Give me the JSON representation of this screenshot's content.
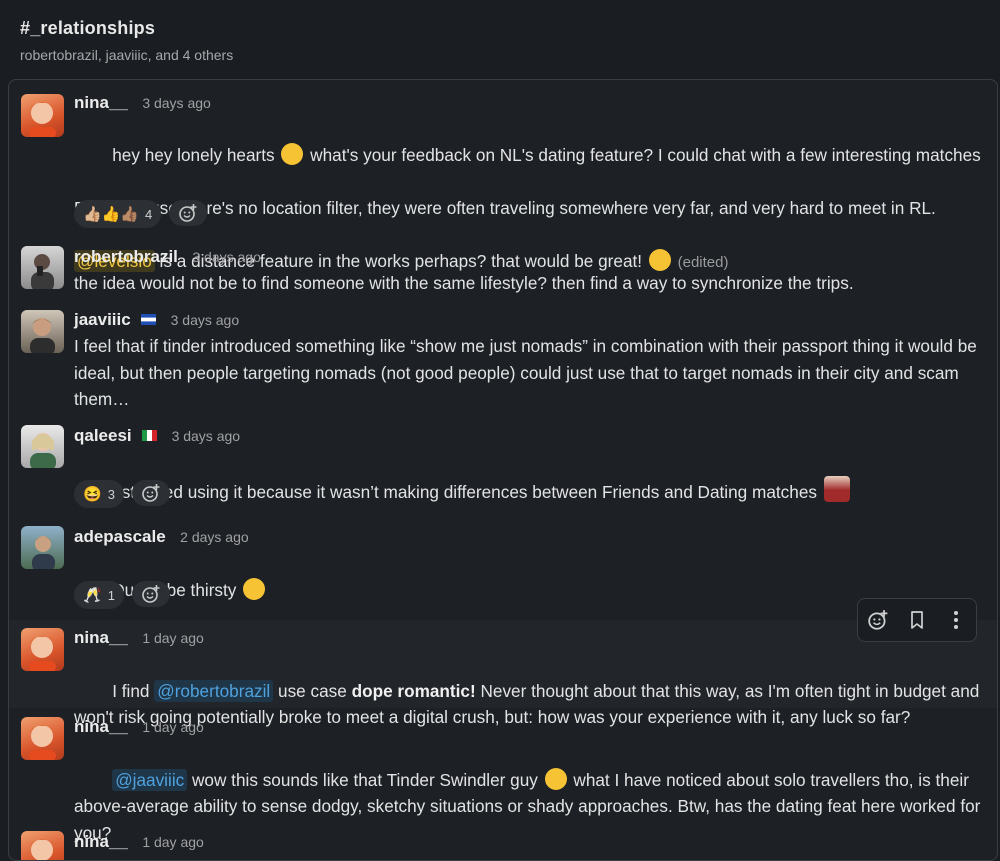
{
  "channel": {
    "title": "#_relationships",
    "members": "robertobrazil, jaaviiic, and 4 others"
  },
  "messages": [
    {
      "author": "nina__",
      "time": "3 days ago",
      "text_1": "hey hey lonely hearts ",
      "text_2": " what's your feedback on NL's dating feature? I could chat with a few interesting matches",
      "text_3": "BUT because there's no location filter, they were often traveling somewhere very far, and very hard to meet in RL.",
      "mention": "@levelsio",
      "text_4": " is a distance feature in the works perhaps? that would be great! ",
      "edited": "(edited)",
      "reactions": [
        {
          "emoji": "👍🏼👍👍🏽",
          "count": "4"
        }
      ]
    },
    {
      "author": "robertobrazil",
      "time": "3 days ago",
      "text": "the idea would not be to find someone with the same lifestyle? then find a way to synchronize the trips."
    },
    {
      "author": "jaaviiic",
      "flag": "🇸🇻",
      "time": "3 days ago",
      "text": "I feel that if tinder introduced something like “show me just nomads” in combination with their passport thing it would be ideal, but then people targeting nomads (not good people) could just use that to target nomads in their city and scam them…"
    },
    {
      "author": "qaleesi",
      "flag": "🇮🇹",
      "time": "3 days ago",
      "text": "I stopped using it because it wasn’t making differences between Friends and Dating matches ",
      "reactions": [
        {
          "emoji": "😆",
          "count": "3"
        }
      ]
    },
    {
      "author": "adepascale",
      "time": "2 days ago",
      "text": "Dudes be thirsty ",
      "reactions": [
        {
          "emoji": "🥂",
          "count": "1"
        }
      ]
    },
    {
      "author": "nina__",
      "time": "1 day ago",
      "text_1": "I find ",
      "mention": "@robertobrazil",
      "text_2": " use case ",
      "bold": "dope romantic!",
      "text_3": " Never thought about that this way, as I'm often tight in budget and won't risk going potentially broke to meet a digital crush, but: how was your experience with it, any luck so far?"
    },
    {
      "author": "nina__",
      "time": "1 day ago",
      "mention": "@jaaviiic",
      "text_1": " wow this sounds like that Tinder Swindler guy ",
      "text_2": " what I have noticed about solo travellers tho, is their above-average ability to sense dodgy, sketchy situations or shady approaches. Btw, has the dating feat here worked for you?"
    },
    {
      "author": "nina__",
      "time": "1 day ago"
    }
  ],
  "colors": {
    "background": "#1a1d21",
    "mention_yellow": "#f2c744",
    "mention_blue": "#4fa2de"
  }
}
